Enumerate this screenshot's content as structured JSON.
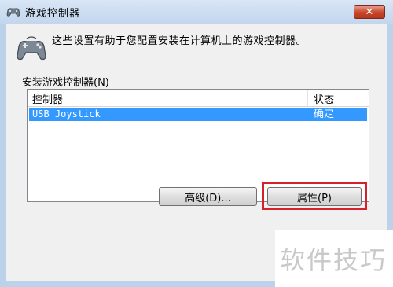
{
  "window": {
    "title": "游戏控制器",
    "close_label": "✕"
  },
  "header": {
    "description": "这些设置有助于您配置安装在计算机上的游戏控制器。",
    "icon": "gamepad-icon"
  },
  "group": {
    "label": "安装游戏控制器(N)"
  },
  "list": {
    "columns": [
      "控制器",
      "状态"
    ],
    "rows": [
      {
        "name": "USB Joystick",
        "status": "确定",
        "selected": true
      }
    ]
  },
  "buttons": {
    "advanced": "高级(D)...",
    "properties": "属性(P)"
  },
  "watermark": "软件技巧",
  "colors": {
    "selection": "#3399ff",
    "highlight": "#d6202c"
  }
}
